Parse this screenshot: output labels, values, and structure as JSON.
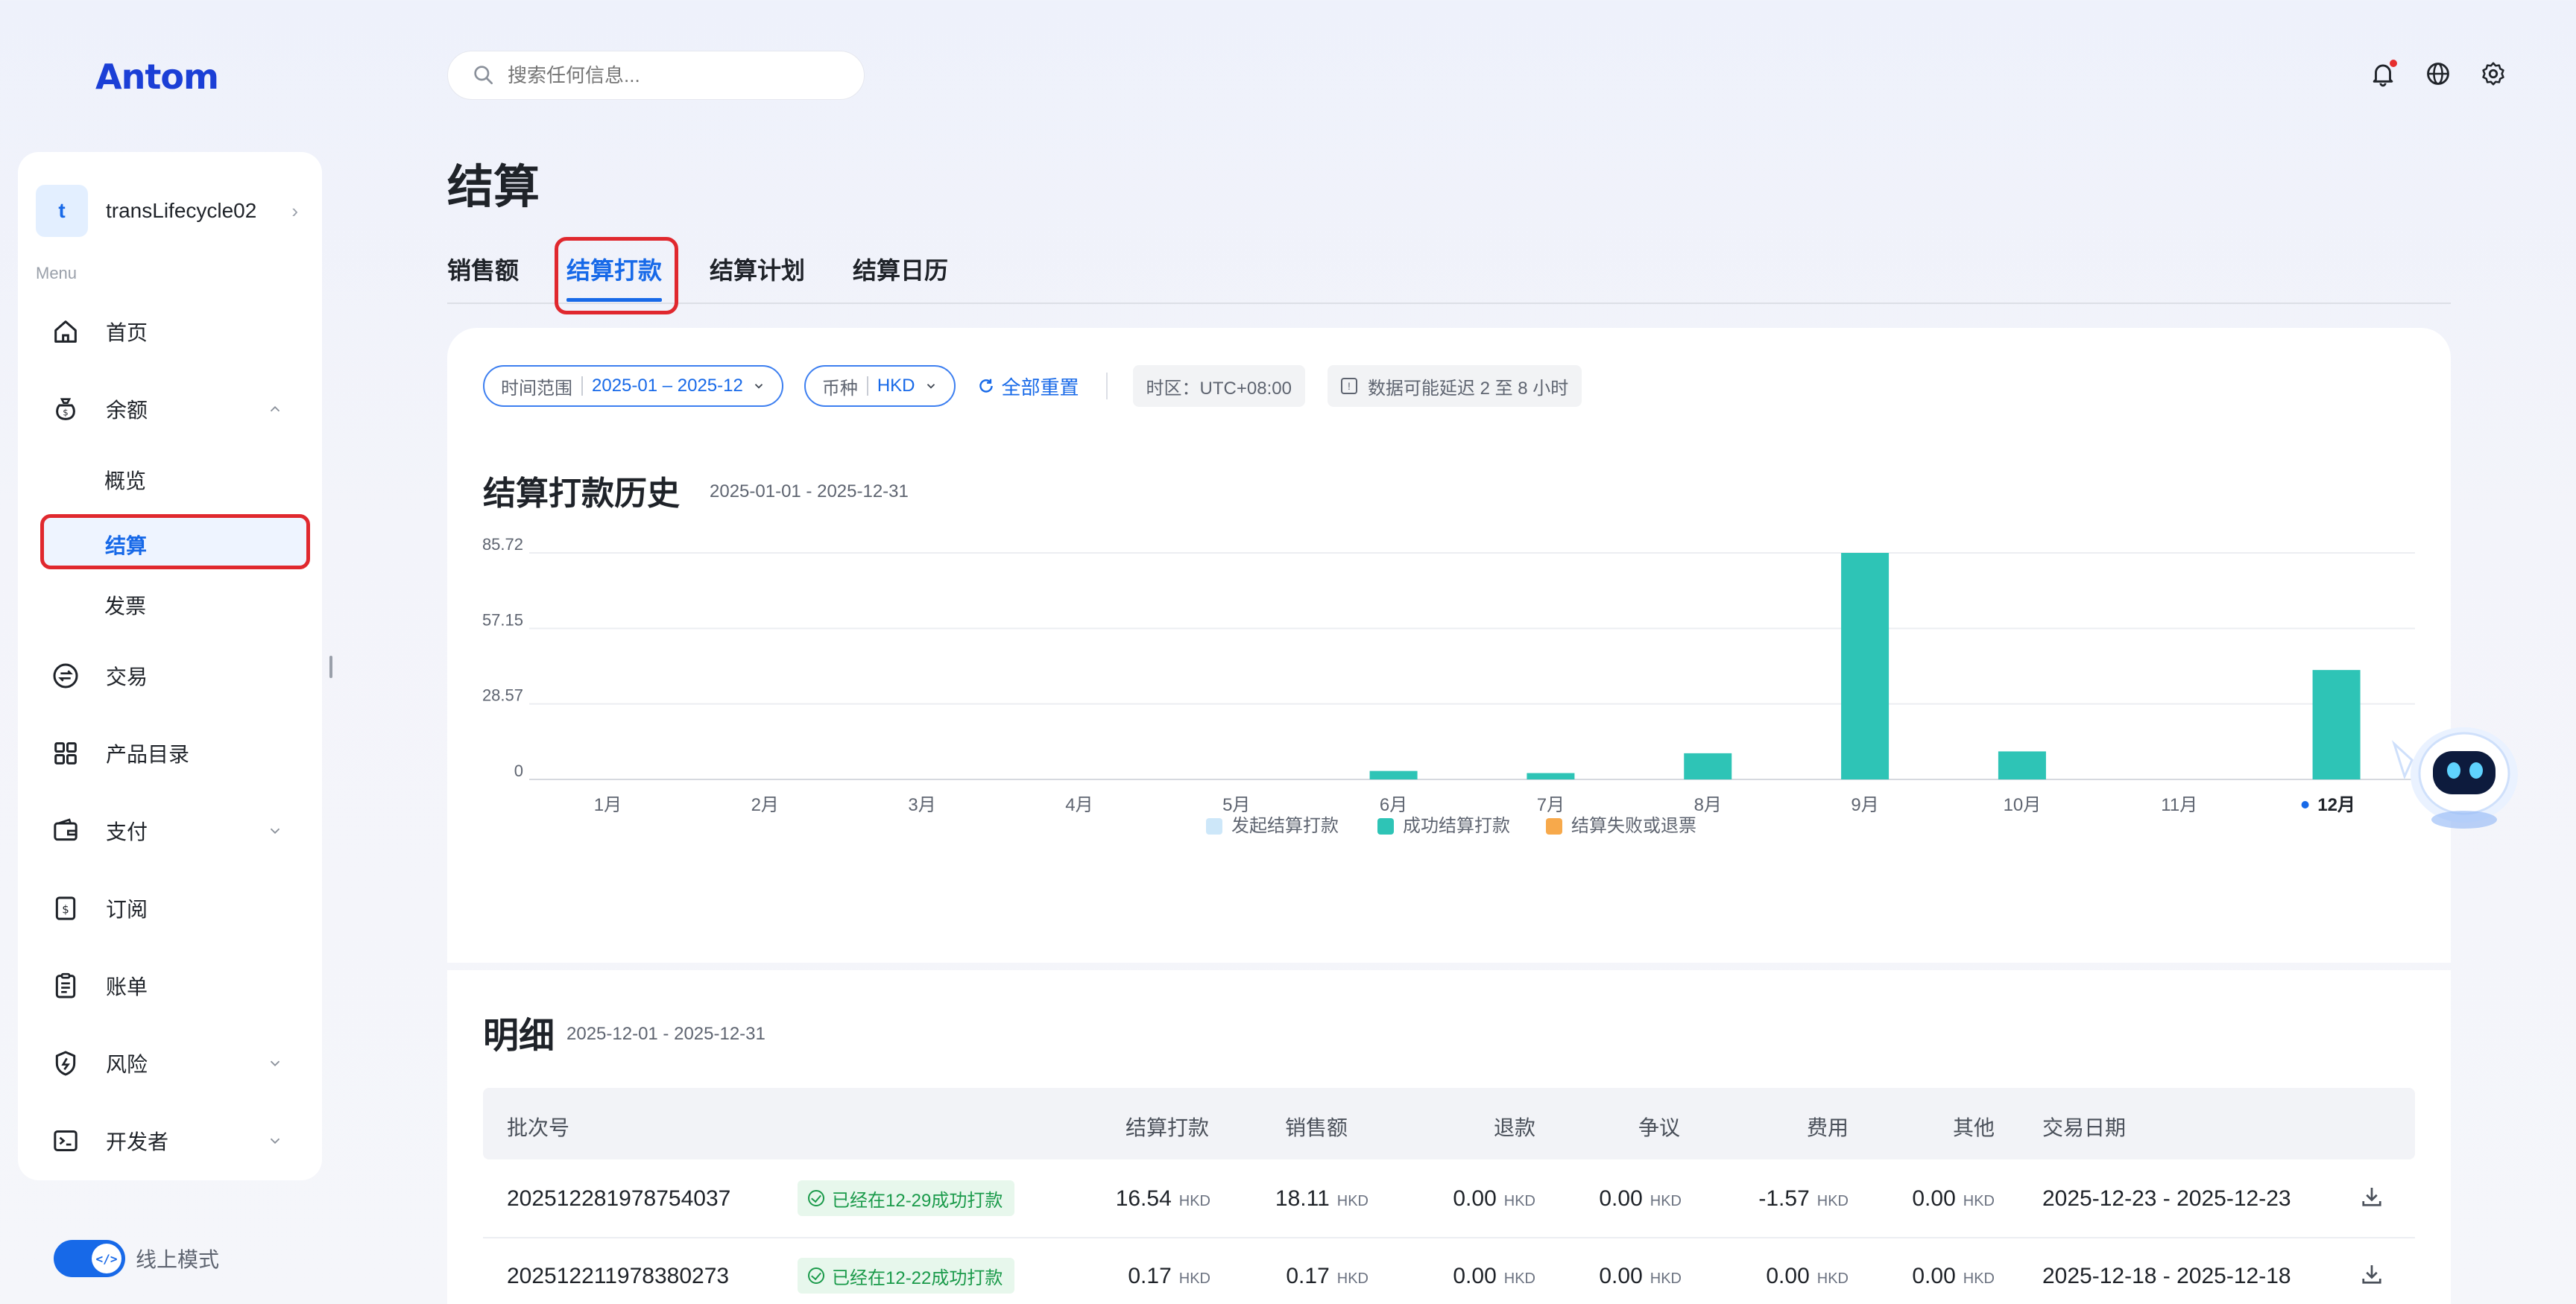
{
  "app": {
    "logo": "Antom"
  },
  "search": {
    "placeholder": "搜索任何信息..."
  },
  "sidebar": {
    "account": {
      "initial": "t",
      "name": "transLifecycle02"
    },
    "menu_label": "Menu",
    "items": [
      {
        "label": "首页",
        "icon": "home-icon"
      },
      {
        "label": "余额",
        "icon": "wallet-money-icon",
        "expanded": true
      },
      {
        "label": "交易",
        "icon": "exchange-icon"
      },
      {
        "label": "产品目录",
        "icon": "grid-icon"
      },
      {
        "label": "支付",
        "icon": "payment-icon"
      },
      {
        "label": "订阅",
        "icon": "subscription-icon"
      },
      {
        "label": "账单",
        "icon": "bill-icon"
      },
      {
        "label": "风险",
        "icon": "shield-icon"
      },
      {
        "label": "开发者",
        "icon": "terminal-icon"
      }
    ],
    "balance_sub": [
      "概览",
      "结算",
      "发票"
    ],
    "mode_label": "线上模式"
  },
  "page": {
    "title": "结算",
    "tabs": [
      "销售额",
      "结算打款",
      "结算计划",
      "结算日历"
    ],
    "active_tab": "结算打款"
  },
  "filters": {
    "time_key": "时间范围",
    "time_value": "2025-01 – 2025-12",
    "currency_key": "币种",
    "currency_value": "HKD",
    "reset": "全部重置",
    "timezone": "时区：UTC+08:00",
    "delay_note": "数据可能延迟 2 至 8 小时"
  },
  "chart_section": {
    "title": "结算打款历史",
    "range": "2025-01-01 - 2025-12-31"
  },
  "chart_data": {
    "type": "bar",
    "categories": [
      "1月",
      "2月",
      "3月",
      "4月",
      "5月",
      "6月",
      "7月",
      "8月",
      "9月",
      "10月",
      "11月",
      "12月"
    ],
    "highlighted_category": "12月",
    "y_ticks": [
      "85.72",
      "57.15",
      "28.57",
      "0"
    ],
    "ylim": [
      0,
      85.72
    ],
    "series": [
      {
        "name": "发起结算打款",
        "color": "#cde7f9",
        "values": [
          0,
          0,
          0,
          0,
          0,
          0,
          0,
          0,
          0,
          0,
          0,
          0
        ]
      },
      {
        "name": "成功结算打款",
        "color": "#2ec4b6",
        "values": [
          0,
          0,
          0,
          0,
          0,
          3.2,
          2.4,
          9.9,
          85.72,
          10.6,
          0,
          41.4
        ]
      },
      {
        "name": "结算失败或退票",
        "color": "#f7a94b",
        "values": [
          0,
          0,
          0,
          0,
          0,
          0,
          0,
          0,
          0,
          0,
          0,
          0
        ]
      }
    ],
    "legend": "bottom-center",
    "grid": true
  },
  "detail": {
    "title": "明细",
    "range": "2025-12-01 - 2025-12-31",
    "columns": [
      "批次号",
      "结算打款",
      "销售额",
      "退款",
      "争议",
      "费用",
      "其他",
      "交易日期"
    ],
    "currency": "HKD",
    "rows": [
      {
        "batch": "202512281978754037",
        "status": "已经在12-29成功打款",
        "settle": "16.54",
        "sales": "18.11",
        "refund": "0.00",
        "dispute": "0.00",
        "fee": "-1.57",
        "other": "0.00",
        "date": "2025-12-23 - 2025-12-23"
      },
      {
        "batch": "202512211978380273",
        "status": "已经在12-22成功打款",
        "settle": "0.17",
        "sales": "0.17",
        "refund": "0.00",
        "dispute": "0.00",
        "fee": "0.00",
        "other": "0.00",
        "date": "2025-12-18 - 2025-12-18"
      }
    ]
  }
}
